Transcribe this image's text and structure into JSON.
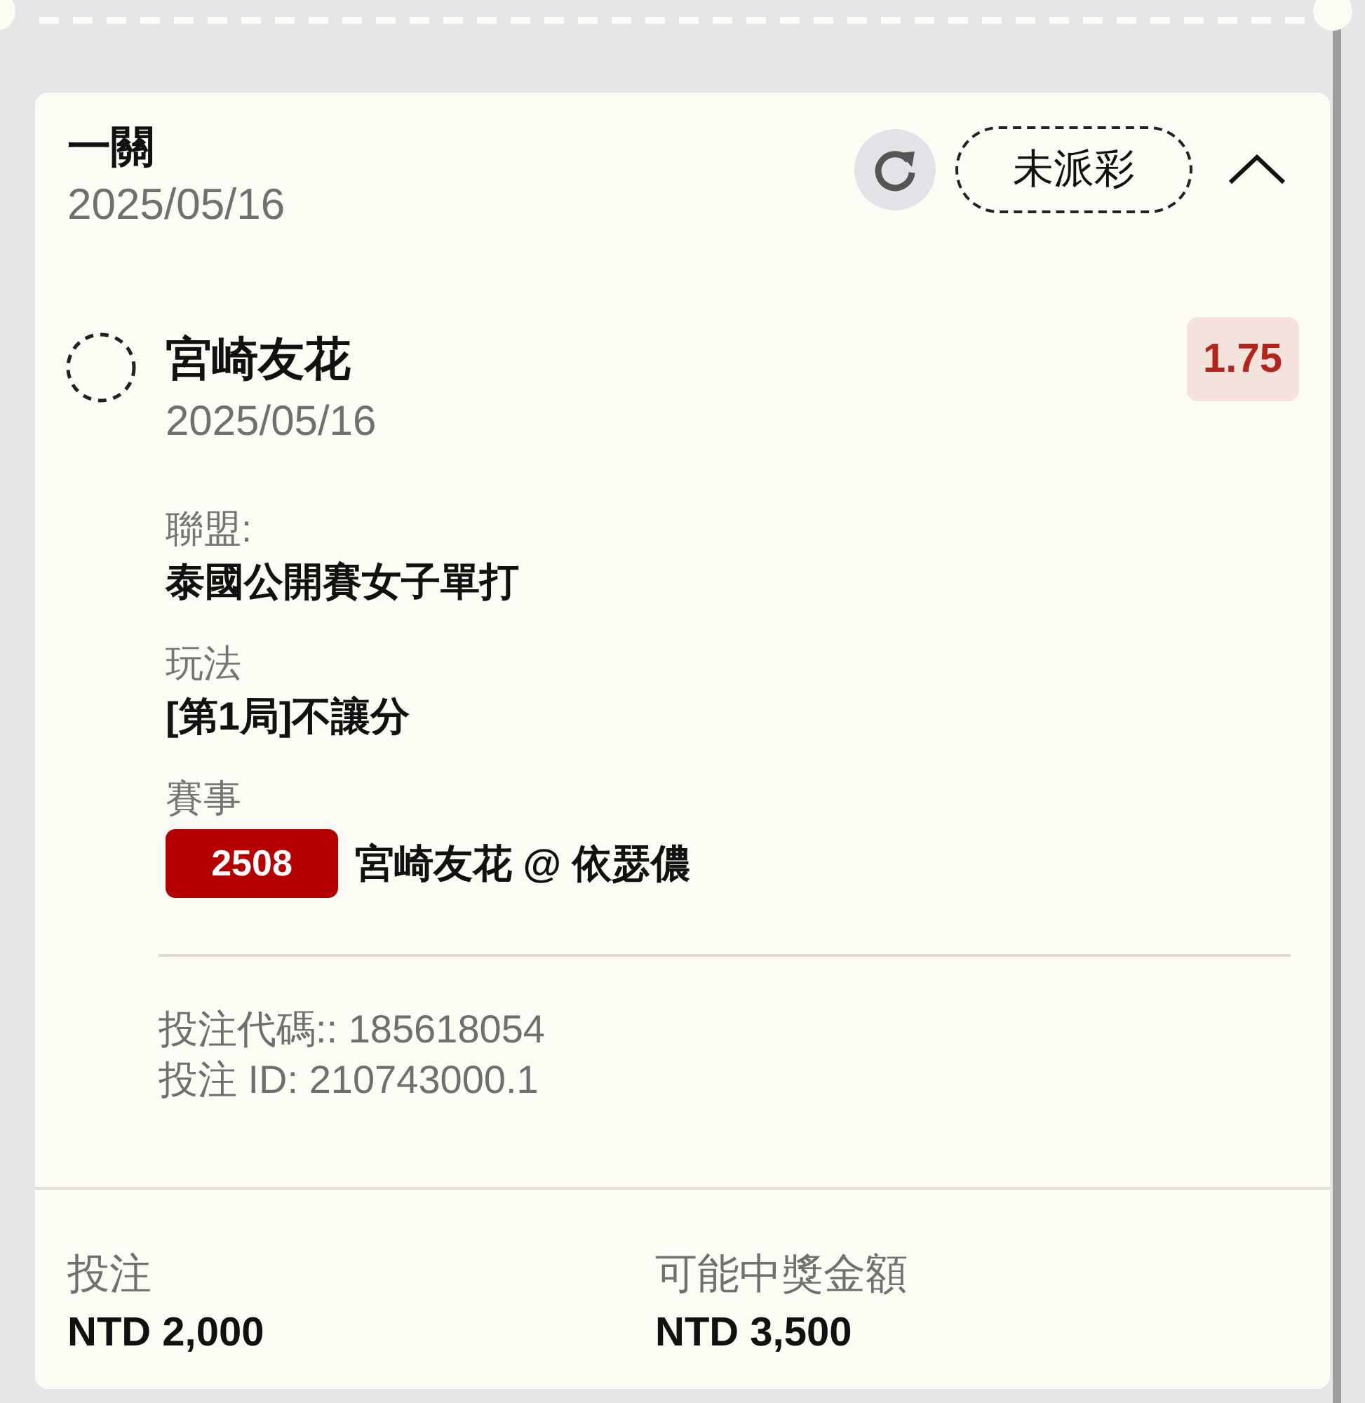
{
  "bet": {
    "title": "一關",
    "date": "2025/05/16",
    "status": "未派彩",
    "expanded": true
  },
  "selection": {
    "name": "宮崎友花",
    "date": "2025/05/16",
    "odds": "1.75"
  },
  "details": [
    {
      "kind": "text",
      "label": "聯盟:",
      "value": "泰國公開賽女子單打"
    },
    {
      "kind": "text",
      "label": "玩法",
      "value": "[第1局]不讓分"
    },
    {
      "kind": "match",
      "label": "賽事",
      "code": "2508",
      "value": "宮崎友花 @ 依瑟儂"
    }
  ],
  "references": [
    "投注代碼:: 185618054",
    "投注 ID: 210743000.1"
  ],
  "summary": [
    {
      "label": "投注",
      "amount": "NTD 2,000"
    },
    {
      "label": "可能中獎金額",
      "amount": "NTD 3,500"
    }
  ]
}
